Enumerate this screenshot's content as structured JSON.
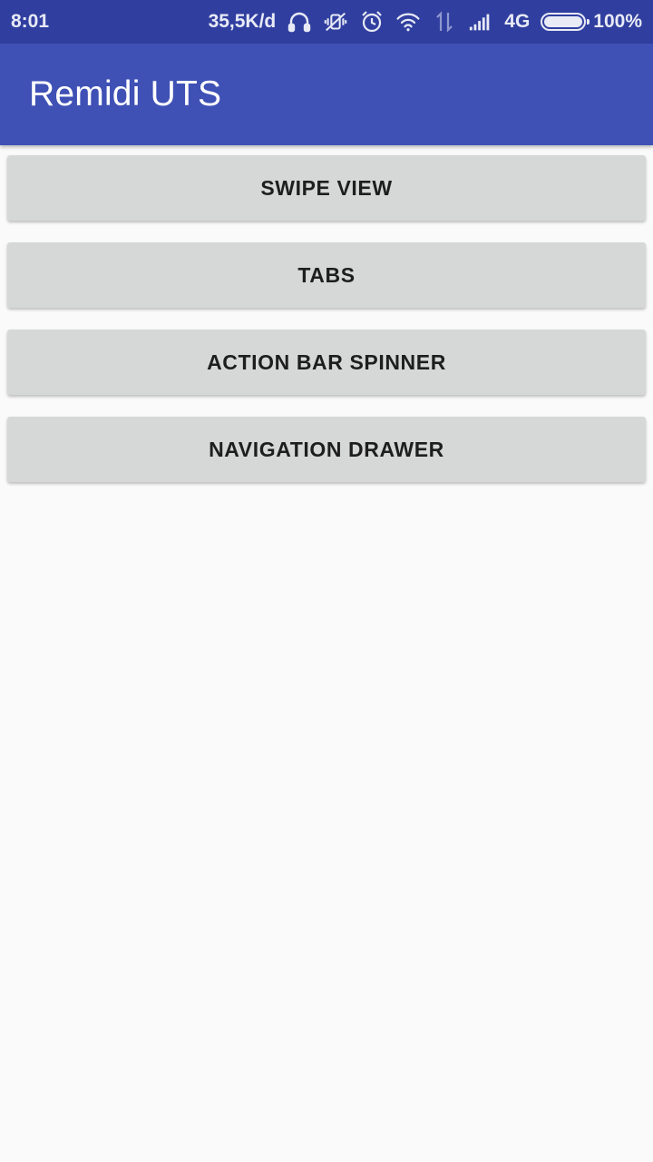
{
  "status_bar": {
    "time": "8:01",
    "net_speed": "35,5K/d",
    "network_type": "4G",
    "battery_percent": "100%",
    "battery_level": 1.0,
    "icons": [
      "headphones-icon",
      "vibrate-off-icon",
      "alarm-icon",
      "wifi-icon",
      "data-transfer-icon",
      "signal-icon"
    ]
  },
  "app_bar": {
    "title": "Remidi UTS",
    "color": "#3f51b5"
  },
  "colors": {
    "status_bar": "#303f9f",
    "button_bg": "#d6d7d7",
    "background": "#fafafa"
  },
  "buttons": [
    {
      "label": "SWIPE VIEW"
    },
    {
      "label": "TABS"
    },
    {
      "label": "ACTION BAR SPINNER"
    },
    {
      "label": "NAVIGATION DRAWER"
    }
  ]
}
